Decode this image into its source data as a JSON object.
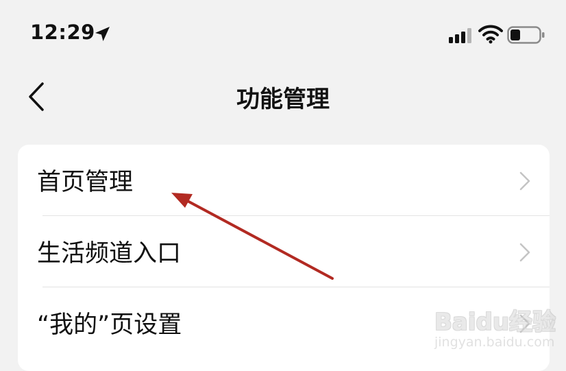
{
  "status_bar": {
    "time": "12:29",
    "icons": [
      "location-arrow-icon",
      "cellular-signal-icon",
      "wifi-icon",
      "battery-icon"
    ]
  },
  "nav": {
    "title": "功能管理",
    "back_icon": "chevron-left-icon"
  },
  "menu": {
    "items": [
      {
        "label": "首页管理"
      },
      {
        "label": "生活频道入口"
      },
      {
        "label": "“我的”页设置"
      }
    ]
  },
  "colors": {
    "background": "#f2f2f2",
    "card": "#ffffff",
    "annotation_arrow": "#b22a22",
    "chevron": "#c4c4c4"
  },
  "watermark": {
    "logo_text": "Baidu经验",
    "url": "jingyan.baidu.com"
  }
}
